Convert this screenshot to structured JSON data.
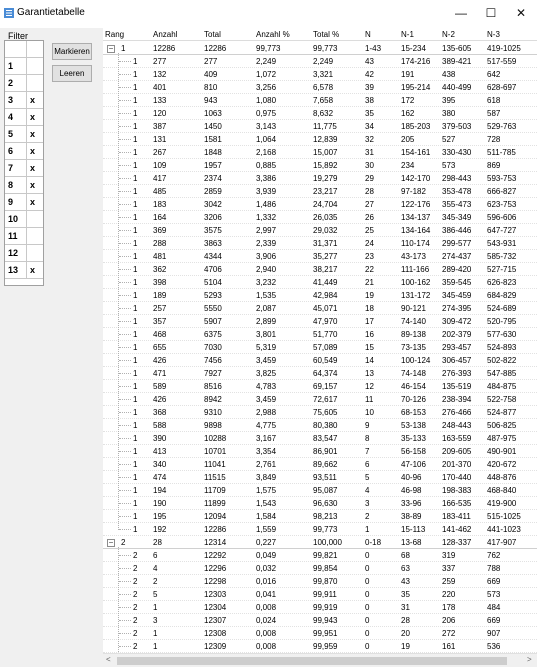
{
  "window": {
    "title": "Garantietabelle",
    "minimize": "—",
    "maximize": "☐",
    "close": "✕"
  },
  "filter": {
    "label": "Filter",
    "rows": [
      {
        "num": "1",
        "mark": ""
      },
      {
        "num": "2",
        "mark": ""
      },
      {
        "num": "3",
        "mark": "x"
      },
      {
        "num": "4",
        "mark": "x"
      },
      {
        "num": "5",
        "mark": "x"
      },
      {
        "num": "6",
        "mark": "x"
      },
      {
        "num": "7",
        "mark": "x"
      },
      {
        "num": "8",
        "mark": "x"
      },
      {
        "num": "9",
        "mark": "x"
      },
      {
        "num": "10",
        "mark": ""
      },
      {
        "num": "11",
        "mark": ""
      },
      {
        "num": "12",
        "mark": ""
      },
      {
        "num": "13",
        "mark": "x"
      }
    ],
    "markieren": "Markieren",
    "leeren": "Leeren"
  },
  "table": {
    "columns": [
      "Rang",
      "Anzahl",
      "Total",
      "Anzahl %",
      "Total %",
      "N",
      "N-1",
      "N-2",
      "N-3"
    ],
    "groups": [
      {
        "expander": "⊟",
        "rang": "1",
        "summary": [
          "12286",
          "12286",
          "99,773",
          "99,773",
          "1-43",
          "15-234",
          "135-605",
          "419-1025"
        ],
        "rows": [
          [
            "1",
            "277",
            "277",
            "2,249",
            "2,249",
            "43",
            "174-216",
            "389-421",
            "517-559"
          ],
          [
            "1",
            "132",
            "409",
            "1,072",
            "3,321",
            "42",
            "191",
            "438",
            "642"
          ],
          [
            "1",
            "401",
            "810",
            "3,256",
            "6,578",
            "39",
            "195-214",
            "440-499",
            "628-697"
          ],
          [
            "1",
            "133",
            "943",
            "1,080",
            "7,658",
            "38",
            "172",
            "395",
            "618"
          ],
          [
            "1",
            "120",
            "1063",
            "0,975",
            "8,632",
            "35",
            "162",
            "380",
            "587"
          ],
          [
            "1",
            "387",
            "1450",
            "3,143",
            "11,775",
            "34",
            "185-203",
            "379-503",
            "529-763"
          ],
          [
            "1",
            "131",
            "1581",
            "1,064",
            "12,839",
            "32",
            "205",
            "527",
            "728"
          ],
          [
            "1",
            "267",
            "1848",
            "2,168",
            "15,007",
            "31",
            "154-161",
            "330-430",
            "511-785"
          ],
          [
            "1",
            "109",
            "1957",
            "0,885",
            "15,892",
            "30",
            "234",
            "573",
            "869"
          ],
          [
            "1",
            "417",
            "2374",
            "3,386",
            "19,279",
            "29",
            "142-170",
            "298-443",
            "593-753"
          ],
          [
            "1",
            "485",
            "2859",
            "3,939",
            "23,217",
            "28",
            "97-182",
            "353-478",
            "666-827"
          ],
          [
            "1",
            "183",
            "3042",
            "1,486",
            "24,704",
            "27",
            "122-176",
            "355-473",
            "623-753"
          ],
          [
            "1",
            "164",
            "3206",
            "1,332",
            "26,035",
            "26",
            "134-137",
            "345-349",
            "596-606"
          ],
          [
            "1",
            "369",
            "3575",
            "2,997",
            "29,032",
            "25",
            "134-164",
            "386-446",
            "647-727"
          ],
          [
            "1",
            "288",
            "3863",
            "2,339",
            "31,371",
            "24",
            "110-174",
            "299-577",
            "543-931"
          ],
          [
            "1",
            "481",
            "4344",
            "3,906",
            "35,277",
            "23",
            "43-173",
            "274-437",
            "585-732"
          ],
          [
            "1",
            "362",
            "4706",
            "2,940",
            "38,217",
            "22",
            "111-166",
            "289-420",
            "527-715"
          ],
          [
            "1",
            "398",
            "5104",
            "3,232",
            "41,449",
            "21",
            "100-162",
            "359-545",
            "626-823"
          ],
          [
            "1",
            "189",
            "5293",
            "1,535",
            "42,984",
            "19",
            "131-172",
            "345-459",
            "684-829"
          ],
          [
            "1",
            "257",
            "5550",
            "2,087",
            "45,071",
            "18",
            "90-121",
            "274-395",
            "524-689"
          ],
          [
            "1",
            "357",
            "5907",
            "2,899",
            "47,970",
            "17",
            "74-140",
            "309-472",
            "520-795"
          ],
          [
            "1",
            "468",
            "6375",
            "3,801",
            "51,770",
            "16",
            "89-138",
            "202-379",
            "577-630"
          ],
          [
            "1",
            "655",
            "7030",
            "5,319",
            "57,089",
            "15",
            "73-135",
            "293-457",
            "524-893"
          ],
          [
            "1",
            "426",
            "7456",
            "3,459",
            "60,549",
            "14",
            "100-124",
            "306-457",
            "502-822"
          ],
          [
            "1",
            "471",
            "7927",
            "3,825",
            "64,374",
            "13",
            "74-148",
            "276-393",
            "547-885"
          ],
          [
            "1",
            "589",
            "8516",
            "4,783",
            "69,157",
            "12",
            "46-154",
            "135-519",
            "484-875"
          ],
          [
            "1",
            "426",
            "8942",
            "3,459",
            "72,617",
            "11",
            "70-126",
            "238-394",
            "522-758"
          ],
          [
            "1",
            "368",
            "9310",
            "2,988",
            "75,605",
            "10",
            "68-153",
            "276-466",
            "524-877"
          ],
          [
            "1",
            "588",
            "9898",
            "4,775",
            "80,380",
            "9",
            "53-138",
            "248-443",
            "506-825"
          ],
          [
            "1",
            "390",
            "10288",
            "3,167",
            "83,547",
            "8",
            "35-133",
            "163-559",
            "487-975"
          ],
          [
            "1",
            "413",
            "10701",
            "3,354",
            "86,901",
            "7",
            "56-158",
            "209-605",
            "490-901"
          ],
          [
            "1",
            "340",
            "11041",
            "2,761",
            "89,662",
            "6",
            "47-106",
            "201-370",
            "420-672"
          ],
          [
            "1",
            "474",
            "11515",
            "3,849",
            "93,511",
            "5",
            "40-96",
            "170-440",
            "448-876"
          ],
          [
            "1",
            "194",
            "11709",
            "1,575",
            "95,087",
            "4",
            "46-98",
            "198-383",
            "468-840"
          ],
          [
            "1",
            "190",
            "11899",
            "1,543",
            "96,630",
            "3",
            "33-96",
            "166-535",
            "419-900"
          ],
          [
            "1",
            "195",
            "12094",
            "1,584",
            "98,213",
            "2",
            "38-89",
            "183-411",
            "515-1025"
          ],
          [
            "1",
            "192",
            "12286",
            "1,559",
            "99,773",
            "1",
            "15-113",
            "141-462",
            "441-1023"
          ]
        ]
      },
      {
        "expander": "⊟",
        "rang": "2",
        "summary": [
          "28",
          "12314",
          "0,227",
          "100,000",
          "0-18",
          "13-68",
          "128-337",
          "417-907"
        ],
        "rows": [
          [
            "2",
            "6",
            "12292",
            "0,049",
            "99,821",
            "0",
            "68",
            "319",
            "762"
          ],
          [
            "2",
            "4",
            "12296",
            "0,032",
            "99,854",
            "0",
            "63",
            "337",
            "788"
          ],
          [
            "2",
            "2",
            "12298",
            "0,016",
            "99,870",
            "0",
            "43",
            "259",
            "669"
          ],
          [
            "2",
            "5",
            "12303",
            "0,041",
            "99,911",
            "0",
            "35",
            "220",
            "573"
          ],
          [
            "2",
            "1",
            "12304",
            "0,008",
            "99,919",
            "0",
            "31",
            "178",
            "484"
          ],
          [
            "2",
            "3",
            "12307",
            "0,024",
            "99,943",
            "0",
            "28",
            "206",
            "669"
          ],
          [
            "2",
            "1",
            "12308",
            "0,008",
            "99,951",
            "0",
            "20",
            "272",
            "907"
          ],
          [
            "2",
            "1",
            "12309",
            "0,008",
            "99,959",
            "0",
            "19",
            "161",
            "536"
          ],
          [
            "2",
            "5",
            "12314",
            "0,041",
            "100,000",
            "0",
            "13",
            "128",
            "417"
          ]
        ]
      }
    ]
  },
  "scrollbar": {
    "left_arrow": "<",
    "right_arrow": ">"
  }
}
